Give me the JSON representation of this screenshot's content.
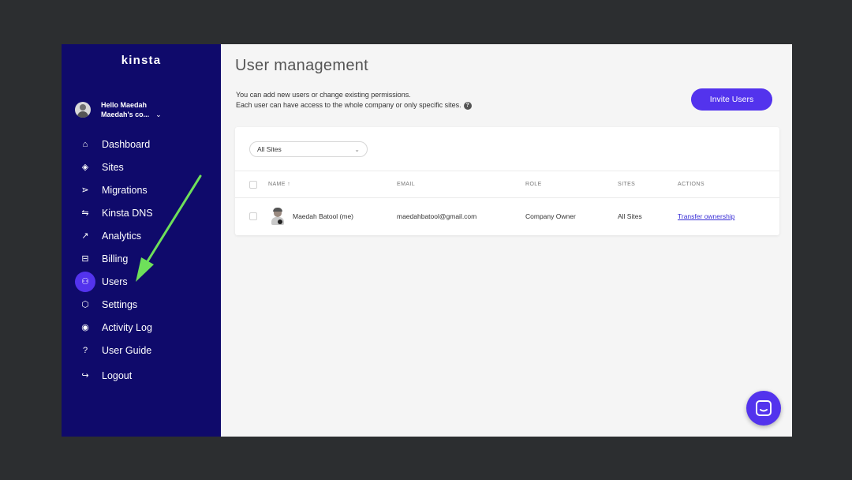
{
  "sidebar": {
    "logo": "kinsta",
    "account": {
      "greeting": "Hello Maedah",
      "company": "Maedah's co..."
    },
    "nav": [
      {
        "label": "Dashboard",
        "icon": "home-icon",
        "glyph": "⌂",
        "active": false
      },
      {
        "label": "Sites",
        "icon": "layers-icon",
        "glyph": "◈",
        "active": false
      },
      {
        "label": "Migrations",
        "icon": "migrate-icon",
        "glyph": "⋗",
        "active": false
      },
      {
        "label": "Kinsta DNS",
        "icon": "dns-icon",
        "glyph": "⇋",
        "active": false
      },
      {
        "label": "Analytics",
        "icon": "trend-icon",
        "glyph": "↗",
        "active": false
      },
      {
        "label": "Billing",
        "icon": "billing-icon",
        "glyph": "⊟",
        "active": false
      },
      {
        "label": "Users",
        "icon": "add-user-icon",
        "glyph": "⚇",
        "active": true
      },
      {
        "label": "Settings",
        "icon": "gear-icon",
        "glyph": "⬡",
        "active": false
      },
      {
        "label": "Activity Log",
        "icon": "eye-icon",
        "glyph": "◉",
        "active": false
      },
      {
        "label": "User Guide",
        "icon": "help-icon",
        "glyph": "?",
        "active": false
      }
    ],
    "logout": {
      "label": "Logout",
      "icon": "logout-icon",
      "glyph": "↪"
    }
  },
  "main": {
    "title": "User management",
    "description": [
      "You can add new users or change existing permissions.",
      "Each user can have access to the whole company or only specific sites."
    ],
    "invite_label": "Invite Users",
    "filter": {
      "value": "All Sites"
    },
    "table": {
      "headers": [
        "NAME",
        "EMAIL",
        "ROLE",
        "SITES",
        "ACTIONS"
      ],
      "sort_indicator": "↑",
      "rows": [
        {
          "name": "Maedah Batool (me)",
          "email": "maedahbatool@gmail.com",
          "role": "Company Owner",
          "sites": "All Sites",
          "action": "Transfer ownership"
        }
      ]
    }
  },
  "colors": {
    "sidebar_bg": "#0f0a6b",
    "accent": "#5333ed",
    "arrow": "#6ee05a"
  }
}
